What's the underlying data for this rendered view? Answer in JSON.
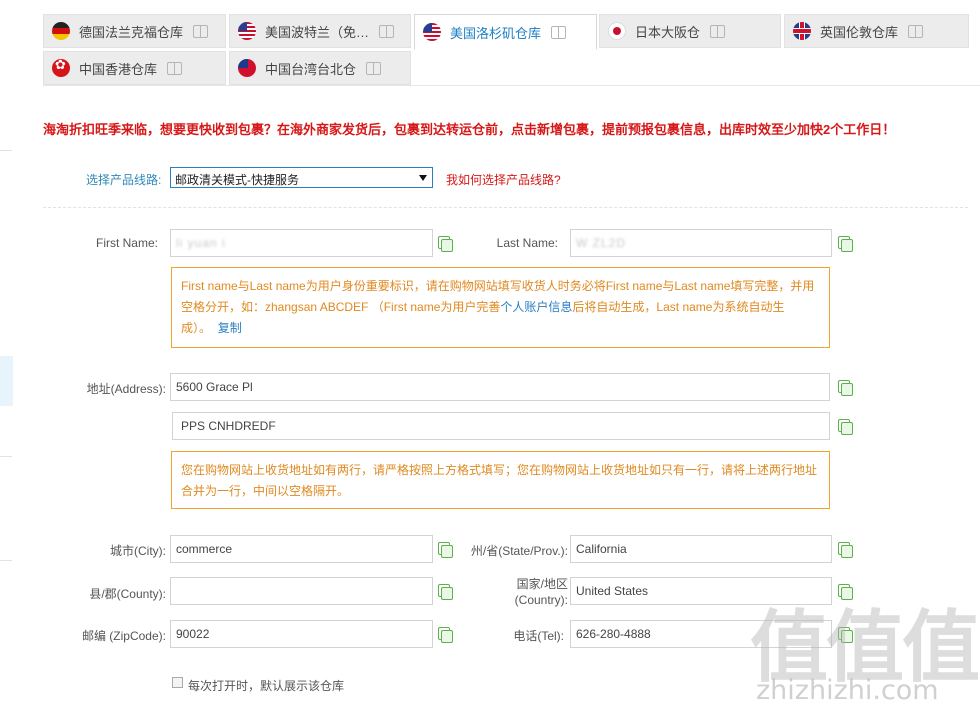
{
  "tabs": [
    {
      "label": "德国法兰克福仓库",
      "flag": "germany-flag-icon",
      "active": false
    },
    {
      "label": "美国波特兰（免…",
      "flag": "usa-flag-icon",
      "active": false
    },
    {
      "label": "美国洛杉矶仓库",
      "flag": "usa-flag-icon",
      "active": true
    },
    {
      "label": "日本大阪仓",
      "flag": "japan-flag-icon",
      "active": false
    },
    {
      "label": "英国伦敦仓库",
      "flag": "uk-flag-icon",
      "active": false
    },
    {
      "label": "中国香港仓库",
      "flag": "hong-kong-flag-icon",
      "active": false
    },
    {
      "label": "中国台湾台北仓",
      "flag": "taiwan-flag-icon",
      "active": false
    }
  ],
  "notice": "海淘折扣旺季来临，想要更快收到包裹？在海外商家发货后，包裹到达转运仓前，点击新增包裹，提前预报包裹信息，出库时效至少加快2个工作日！",
  "route": {
    "label": "选择产品线路:",
    "selected": "邮政清关模式-快捷服务",
    "help_link": "我如何选择产品线路?"
  },
  "name": {
    "first_label": "First Name:",
    "first_value": "li yuan i",
    "last_label": "Last Name:",
    "last_value": "W ZL2D"
  },
  "name_hint": {
    "text_1": "First name与Last name为用户身份重要标识，请在购物网站填写收货人时务必将First name与Last name填写完整，并用空格分开，如：zhangsan ABCDEF （First name为用户完善",
    "info_link": "个人账户信息",
    "text_2": "后将自动生成，Last name为系统自动生成）。",
    "copy_link": "复制"
  },
  "address": {
    "label": "地址(Address):",
    "line1": "5600 Grace Pl",
    "line2": "PPS CNHDREDF",
    "hint": "您在购物网站上收货地址如有两行，请严格按照上方格式填写；您在购物网站上收货地址如只有一行，请将上述两行地址合并为一行，中间以空格隔开。"
  },
  "city": {
    "label": "城市(City):",
    "value": "commerce"
  },
  "state": {
    "label": "州/省(State/Prov.):",
    "value": "California"
  },
  "county": {
    "label": "县/郡(County):",
    "value": ""
  },
  "country": {
    "label_1": "国家/地区",
    "label_2": "(Country):",
    "value": "United States"
  },
  "zip": {
    "label": "邮编 (ZipCode):",
    "value": "90022"
  },
  "tel": {
    "label": "电话(Tel):",
    "value": "626-280-4888"
  },
  "default_checkbox": {
    "label": "每次打开时，默认展示该仓库",
    "checked": false
  },
  "watermark": {
    "chars": "值值值",
    "site": "zhizhizhi.com"
  },
  "colors": {
    "accent": "#2a7fc0",
    "notice_red": "#d71818",
    "hint_orange": "#f0a52a",
    "copy_green": "#59b24a"
  }
}
